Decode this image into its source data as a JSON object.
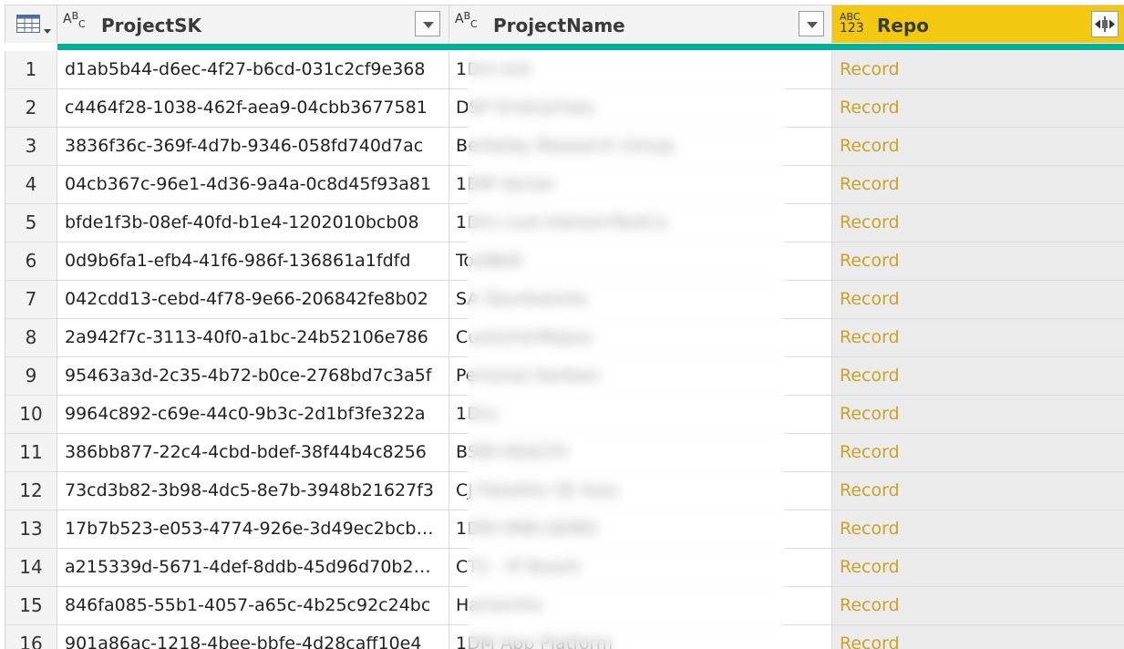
{
  "header": {
    "col1": {
      "type_icon": "ABC-text-type-icon",
      "label": "ProjectSK"
    },
    "col2": {
      "type_icon": "ABC-text-type-icon",
      "label": "ProjectName"
    },
    "col3": {
      "type_icon": "ABC-123-any-type-icon",
      "type_line1": "ABC",
      "type_line2": "123",
      "label": "Repo"
    }
  },
  "colors": {
    "selected_header": "#f2c811",
    "quality_bar": "#00b294",
    "record_link": "#c9a227"
  },
  "rows": [
    {
      "n": "1",
      "sk": "d1ab5b44-d6ec-4f27-b6cd-031c2cf9e368",
      "name": "1Dm-ILD",
      "repo": "Record"
    },
    {
      "n": "2",
      "sk": "c4464f28-1038-462f-aea9-04cbb3677581",
      "name": "DSP Enterprises",
      "repo": "Record"
    },
    {
      "n": "3",
      "sk": "3836f36c-369f-4d7b-9346-058fd740d7ac",
      "name": "Berkeley Research Group",
      "repo": "Record"
    },
    {
      "n": "4",
      "sk": "04cb367c-96e1-4d36-9a4a-0c8d45f93a81",
      "name": "1DM Varian",
      "repo": "Record"
    },
    {
      "n": "5",
      "sk": "bfde1f3b-08ef-40fd-b1e4-1202010bcb08",
      "name": "1Dm-cust-HansonTestCo",
      "repo": "Record"
    },
    {
      "n": "6",
      "sk": "0d9b6fa1-efb4-41f6-986f-136861a1fdfd",
      "name": "ToolBelt",
      "repo": "Record"
    },
    {
      "n": "7",
      "sk": "042cdd13-cebd-4f78-9e66-206842fe8b02",
      "name": "SA Skunkworks",
      "repo": "Record"
    },
    {
      "n": "8",
      "sk": "2a942f7c-3113-40f0-a1bc-24b52106e786",
      "name": "CustomerRepos",
      "repo": "Record"
    },
    {
      "n": "9",
      "sk": "95463a3d-2c35-4b72-b0ce-2768bd7c3a5f",
      "name": "Personal Kanban",
      "repo": "Record"
    },
    {
      "n": "10",
      "sk": "9964c892-c69e-44c0-9b3c-2d1bf3fe322a",
      "name": "1Dru",
      "repo": "Record"
    },
    {
      "n": "11",
      "sk": "386bb877-22c4-4cbd-bdef-38f44b4c8256",
      "name": "BSW-HEALTH",
      "repo": "Record"
    },
    {
      "n": "12",
      "sk": "73cd3b82-3b98-4dc5-8e7b-3948b21627f3",
      "name": "CJ PaloAlto SE Asia",
      "repo": "Record"
    },
    {
      "n": "13",
      "sk": "17b7b523-e053-4774-926e-3d49ec2bcb…",
      "name": "1DM-HRB-DEMO",
      "repo": "Record"
    },
    {
      "n": "14",
      "sk": "a215339d-5671-4def-8ddb-45d96d70b2…",
      "name": "CT2 - IP Board",
      "repo": "Record"
    },
    {
      "n": "15",
      "sk": "846fa085-55b1-4057-a65c-4b25c92c24bc",
      "name": "Hansonho",
      "repo": "Record"
    },
    {
      "n": "16",
      "sk": "901a86ac-1218-4bee-bbfe-4d28caff10e4",
      "name": "1DM App Platform",
      "repo": "Record"
    }
  ]
}
